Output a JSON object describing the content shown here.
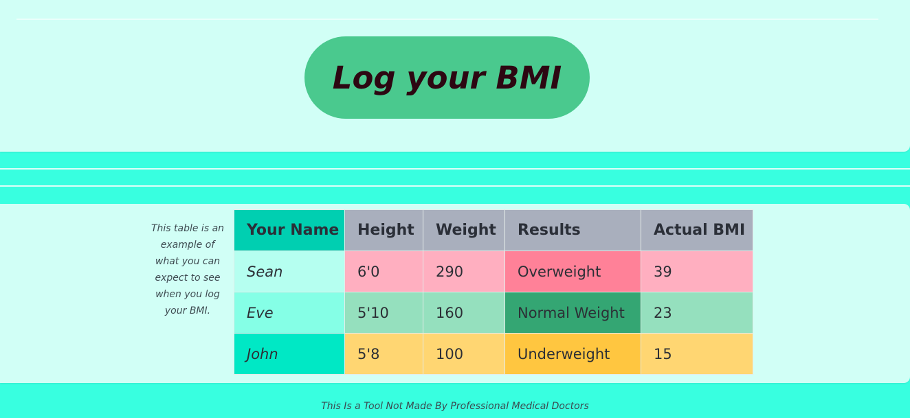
{
  "header": {
    "button_label": "Log your BMI"
  },
  "example": {
    "caption": "This table is an example of what you can expect to see when you log your BMI."
  },
  "table": {
    "headers": [
      "Your Name",
      "Height",
      "Weight",
      "Results",
      "Actual BMI"
    ],
    "rows": [
      {
        "name": "Sean",
        "height": "6'0",
        "weight": "290",
        "result": "Overweight",
        "bmi": "39",
        "colors": {
          "name": "#b5fff0",
          "row": "#ffafc0",
          "result": "#ff8198"
        }
      },
      {
        "name": "Eve",
        "height": "5'10",
        "weight": "160",
        "result": "Normal Weight",
        "bmi": "23",
        "colors": {
          "name": "#85ffe6",
          "row": "#95e0be",
          "result": "#34a673"
        }
      },
      {
        "name": "John",
        "height": "5'8",
        "weight": "100",
        "result": "Underweight",
        "bmi": "15",
        "colors": {
          "name": "#00e8c5",
          "row": "#ffd672",
          "result": "#ffc640"
        }
      }
    ]
  },
  "footer": {
    "note": "This Is a Tool Not Made By Professional Medical Doctors"
  },
  "colors": {
    "page_background": "#38ffe0",
    "panel_background": "#d1fff6",
    "button_background": "#4ac98e",
    "button_text": "#2d0712",
    "header_cell": "#a9afbd",
    "name_header_cell": "#00cfb1"
  }
}
